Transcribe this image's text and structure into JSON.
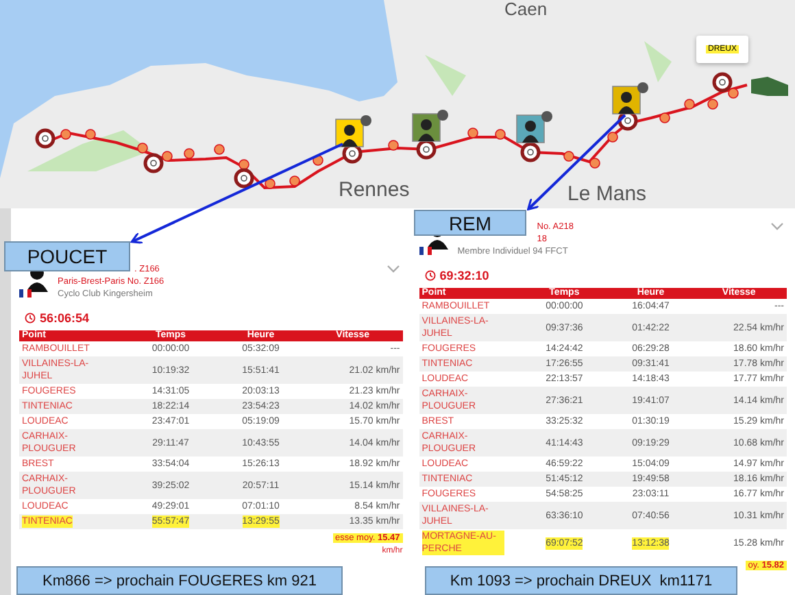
{
  "map": {
    "labels": [
      {
        "text": "Caen"
      },
      {
        "text": "Rennes"
      },
      {
        "text": "Le Mans"
      }
    ],
    "popup": "DREUX"
  },
  "riders": [
    {
      "callout": "POUCET",
      "title": ". Z166",
      "event": "Paris-Brest-Paris No. Z166",
      "club": "Cyclo Club Kingersheim",
      "elapsed": "56:06:54",
      "columns": [
        "Point",
        "Temps",
        "Heure",
        "Vitesse"
      ],
      "rows": [
        {
          "point": "RAMBOUILLET",
          "temps": "00:00:00",
          "heure": "05:32:09",
          "vitesse": "---",
          "highlighted": false
        },
        {
          "point": "VILLAINES-LA-JUHEL",
          "temps": "10:19:32",
          "heure": "15:51:41",
          "vitesse": "21.02 km/hr",
          "highlighted": false
        },
        {
          "point": "FOUGERES",
          "temps": "14:31:05",
          "heure": "20:03:13",
          "vitesse": "21.23 km/hr",
          "highlighted": false
        },
        {
          "point": "TINTENIAC",
          "temps": "18:22:14",
          "heure": "23:54:23",
          "vitesse": "14.02 km/hr",
          "highlighted": false
        },
        {
          "point": "LOUDEAC",
          "temps": "23:47:01",
          "heure": "05:19:09",
          "vitesse": "15.70 km/hr",
          "highlighted": false
        },
        {
          "point": "CARHAIX-PLOUGUER",
          "temps": "29:11:47",
          "heure": "10:43:55",
          "vitesse": "14.04 km/hr",
          "highlighted": false
        },
        {
          "point": "BREST",
          "temps": "33:54:04",
          "heure": "15:26:13",
          "vitesse": "18.92 km/hr",
          "highlighted": false
        },
        {
          "point": "CARHAIX-PLOUGUER",
          "temps": "39:25:02",
          "heure": "20:57:11",
          "vitesse": "15.14 km/hr",
          "highlighted": false
        },
        {
          "point": "LOUDEAC",
          "temps": "49:29:01",
          "heure": "07:01:10",
          "vitesse": "8.54 km/hr",
          "highlighted": false
        },
        {
          "point": "TINTENIAC",
          "temps": "55:57:47",
          "heure": "13:29:55",
          "vitesse": "13.35 km/hr",
          "highlighted": true
        }
      ],
      "average": {
        "label": "esse moy.",
        "value": "15.47",
        "unit": "km/hr"
      },
      "note": "Km866 => prochain FOUGERES km 921"
    },
    {
      "callout": "REM",
      "title": "No. A218",
      "subtitle": "18",
      "club": "Membre Individuel 94 FFCT",
      "elapsed": "69:32:10",
      "columns": [
        "Point",
        "Temps",
        "Heure",
        "Vitesse"
      ],
      "rows": [
        {
          "point": "RAMBOUILLET",
          "temps": "00:00:00",
          "heure": "16:04:47",
          "vitesse": "---",
          "highlighted": false
        },
        {
          "point": "VILLAINES-LA-JUHEL",
          "temps": "09:37:36",
          "heure": "01:42:22",
          "vitesse": "22.54 km/hr",
          "highlighted": false
        },
        {
          "point": "FOUGERES",
          "temps": "14:24:42",
          "heure": "06:29:28",
          "vitesse": "18.60 km/hr",
          "highlighted": false
        },
        {
          "point": "TINTENIAC",
          "temps": "17:26:55",
          "heure": "09:31:41",
          "vitesse": "17.78 km/hr",
          "highlighted": false
        },
        {
          "point": "LOUDEAC",
          "temps": "22:13:57",
          "heure": "14:18:43",
          "vitesse": "17.77 km/hr",
          "highlighted": false
        },
        {
          "point": "CARHAIX-PLOUGUER",
          "temps": "27:36:21",
          "heure": "19:41:07",
          "vitesse": "14.14 km/hr",
          "highlighted": false
        },
        {
          "point": "BREST",
          "temps": "33:25:32",
          "heure": "01:30:19",
          "vitesse": "15.29 km/hr",
          "highlighted": false
        },
        {
          "point": "CARHAIX-PLOUGUER",
          "temps": "41:14:43",
          "heure": "09:19:29",
          "vitesse": "10.68 km/hr",
          "highlighted": false
        },
        {
          "point": "LOUDEAC",
          "temps": "46:59:22",
          "heure": "15:04:09",
          "vitesse": "14.97 km/hr",
          "highlighted": false
        },
        {
          "point": "TINTENIAC",
          "temps": "51:45:12",
          "heure": "19:49:58",
          "vitesse": "18.16 km/hr",
          "highlighted": false
        },
        {
          "point": "FOUGERES",
          "temps": "54:58:25",
          "heure": "23:03:11",
          "vitesse": "16.77 km/hr",
          "highlighted": false
        },
        {
          "point": "VILLAINES-LA-JUHEL",
          "temps": "63:36:10",
          "heure": "07:40:56",
          "vitesse": "10.31 km/hr",
          "highlighted": false
        },
        {
          "point": "MORTAGNE-AU-PERCHE",
          "temps": "69:07:52",
          "heure": "13:12:38",
          "vitesse": "15.28 km/hr",
          "highlighted": true
        }
      ],
      "average": {
        "label": "oy.",
        "value": "15.82"
      },
      "note": "Km 1093 => prochain DREUX  km1171"
    }
  ]
}
